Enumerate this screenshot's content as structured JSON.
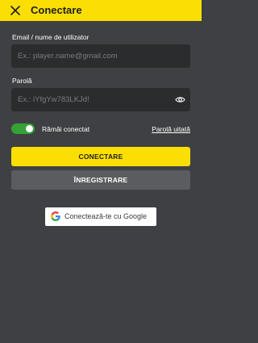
{
  "header": {
    "title": "Conectare",
    "close_icon": "close-icon",
    "background": "#fbdf04"
  },
  "form": {
    "email_label": "Email / nume de utilizator",
    "email_placeholder": "Ex.: player.name@gmail.com",
    "email_value": "",
    "password_label": "Parolă",
    "password_placeholder": "Ex.: iYfgYw783LKJd!",
    "password_value": "",
    "password_visibility_icon": "eye-icon",
    "remember_label": "Rămâi conectat",
    "remember_checked": true,
    "forgot_link": "Parolă uitată"
  },
  "actions": {
    "login_label": "CONECTARE",
    "register_label": "ÎNREGISTRARE",
    "google_label": "Conectează-te cu Google",
    "google_icon": "google-icon"
  },
  "colors": {
    "accent": "#fbdf04",
    "toggle_on": "#35a236",
    "background": "#3f4043",
    "input_bg": "#2b2c2e",
    "secondary_button": "#5b5c60"
  }
}
